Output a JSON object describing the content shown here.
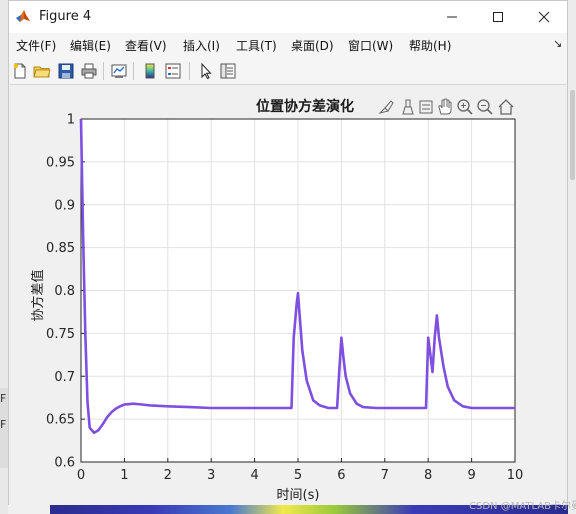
{
  "window": {
    "title": "Figure 4",
    "controls": [
      "minimize-icon",
      "maximize-icon",
      "close-icon"
    ]
  },
  "menubar": {
    "items": [
      {
        "label": "文件(F)"
      },
      {
        "label": "编辑(E)"
      },
      {
        "label": "查看(V)"
      },
      {
        "label": "插入(I)"
      },
      {
        "label": "工具(T)"
      },
      {
        "label": "桌面(D)"
      },
      {
        "label": "窗口(W)"
      },
      {
        "label": "帮助(H)"
      }
    ],
    "overflow_arrow": "↘"
  },
  "toolbar": {
    "icons": [
      "new-figure-icon",
      "open-file-icon",
      "save-icon",
      "print-icon",
      "link-plot-icon",
      "colorbar-icon",
      "legend-icon",
      "pointer-icon",
      "property-inspector-icon"
    ]
  },
  "axes_toolbar": {
    "icons": [
      "brush-icon",
      "data-tips-icon",
      "restore-view-icon",
      "pan-icon",
      "zoom-in-icon",
      "zoom-out-icon",
      "home-icon"
    ]
  },
  "background": {
    "side_labels": [
      "F",
      "F"
    ]
  },
  "watermark": "CSDN @MATLAB卡尔曼",
  "chart_data": {
    "type": "line",
    "title": "位置协方差演化",
    "xlabel": "时间(s)",
    "ylabel": "协方差值",
    "xlim": [
      0,
      10
    ],
    "ylim": [
      0.6,
      1.0
    ],
    "xticks": [
      "0",
      "1",
      "2",
      "3",
      "4",
      "5",
      "6",
      "7",
      "8",
      "9",
      "10"
    ],
    "yticks": [
      "0.6",
      "0.65",
      "0.7",
      "0.75",
      "0.8",
      "0.85",
      "0.9",
      "0.95",
      "1"
    ],
    "grid": true,
    "color": "#7e4fe0",
    "series": [
      {
        "x": [
          0,
          0.05,
          0.1,
          0.15,
          0.2,
          0.3,
          0.4,
          0.5,
          0.6,
          0.7,
          0.8,
          0.9,
          1.0,
          1.2,
          1.4,
          1.6,
          2.0,
          2.5,
          3.0,
          3.5,
          4.0,
          4.5,
          4.85,
          4.9,
          4.97,
          5.0,
          5.1,
          5.2,
          5.35,
          5.5,
          5.7,
          5.9,
          5.95,
          6.0,
          6.05,
          6.1,
          6.2,
          6.35,
          6.5,
          6.8,
          7.0,
          7.5,
          7.95,
          8.0,
          8.05,
          8.1,
          8.15,
          8.2,
          8.25,
          8.35,
          8.45,
          8.6,
          8.8,
          9.0,
          9.5,
          10.0
        ],
        "y": [
          1.0,
          0.86,
          0.75,
          0.67,
          0.64,
          0.634,
          0.637,
          0.644,
          0.652,
          0.658,
          0.662,
          0.665,
          0.667,
          0.668,
          0.667,
          0.666,
          0.665,
          0.664,
          0.663,
          0.663,
          0.663,
          0.663,
          0.663,
          0.745,
          0.785,
          0.797,
          0.73,
          0.695,
          0.672,
          0.666,
          0.663,
          0.663,
          0.705,
          0.745,
          0.72,
          0.7,
          0.68,
          0.668,
          0.664,
          0.663,
          0.663,
          0.663,
          0.663,
          0.745,
          0.725,
          0.705,
          0.745,
          0.771,
          0.745,
          0.712,
          0.688,
          0.672,
          0.665,
          0.663,
          0.663,
          0.663
        ]
      }
    ]
  }
}
